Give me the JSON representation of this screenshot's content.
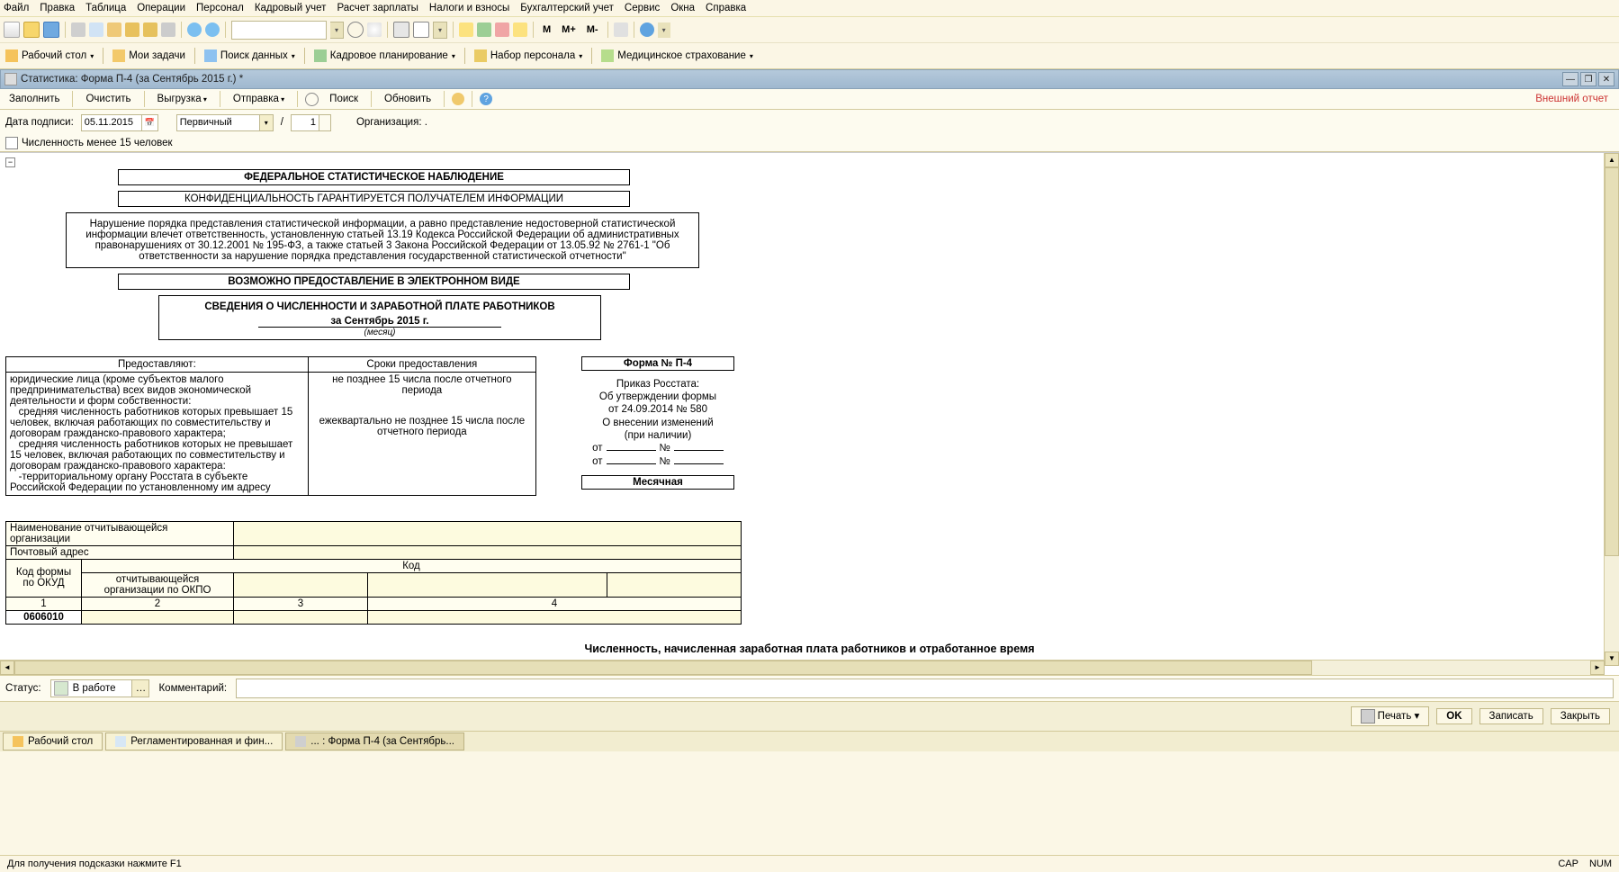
{
  "main_menu": [
    "Файл",
    "Правка",
    "Таблица",
    "Операции",
    "Персонал",
    "Кадровый учет",
    "Расчет зарплаты",
    "Налоги и взносы",
    "Бухгалтерский учет",
    "Сервис",
    "Окна",
    "Справка"
  ],
  "toolbar1": {
    "m_labels": [
      "M",
      "M+",
      "M-"
    ]
  },
  "toolbar2": [
    {
      "icon": "ic-desk",
      "label": "Рабочий стол",
      "dd": true
    },
    {
      "icon": "ic-task",
      "label": "Мои задачи"
    },
    {
      "icon": "ic-data",
      "label": "Поиск данных",
      "dd": true
    },
    {
      "icon": "ic-plan",
      "label": "Кадровое планирование",
      "dd": true
    },
    {
      "icon": "ic-hire",
      "label": "Набор персонала",
      "dd": true
    },
    {
      "icon": "ic-med",
      "label": "Медицинское страхование",
      "dd": true
    }
  ],
  "child_title": "Статистика: Форма П-4 (за Сентябрь 2015 г.) *",
  "child_tb": {
    "fill": "Заполнить",
    "clear": "Очистить",
    "export": "Выгрузка",
    "send": "Отправка",
    "search": "Поиск",
    "refresh": "Обновить"
  },
  "ext_report": "Внешний отчет",
  "params": {
    "date_label": "Дата подписи:",
    "date_val": "05.11.2015",
    "type_val": "Первичный",
    "slash": "/",
    "num_val": "1",
    "org_label": "Организация: ."
  },
  "chk_label": "Численность менее 15 человек",
  "doc": {
    "box1": "ФЕДЕРАЛЬНОЕ СТАТИСТИЧЕСКОЕ НАБЛЮДЕНИЕ",
    "box2": "КОНФИДЕНЦИАЛЬНОСТЬ ГАРАНТИРУЕТСЯ ПОЛУЧАТЕЛЕМ ИНФОРМАЦИИ",
    "box3": "Нарушение порядка представления статистической информации, а равно представление недостоверной статистической информации влечет ответственность, установленную статьей 13.19 Кодекса Российской Федерации об административных правонарушениях от 30.12.2001 № 195-ФЗ, а также статьей 3 Закона Российской Федерации от 13.05.92 № 2761-1 \"Об ответственности за нарушение порядка представления государственной статистической отчетности\"",
    "box4": "ВОЗМОЖНО ПРЕДОСТАВЛЕНИЕ В ЭЛЕКТРОННОМ ВИДЕ",
    "box5_title": "СВЕДЕНИЯ О ЧИСЛЕННОСТИ И ЗАРАБОТНОЙ ПЛАТЕ РАБОТНИКОВ",
    "box5_period": "за Сентябрь 2015 г.",
    "box5_sub": "(месяц)",
    "tblA": {
      "h1": "Предоставляют:",
      "h2": "Сроки предоставления",
      "c1": "юридические лица (кроме субъектов малого предпринимательства) всех видов экономической деятельности и форм собственности:\n   средняя численность работников которых превышает 15 человек, включая работающих по совместительству и договорам гражданско-правового характера;\n   средняя численность работников которых не превышает 15 человек, включая работающих по совместительству и договорам гражданско-правового характера:\n   -территориальному органу Росстата в субъекте Российской Федерации по установленному им адресу",
      "c2a": "не позднее 15 числа после отчетного периода",
      "c2b": "ежеквартально не позднее 15 числа после отчетного периода"
    },
    "form_no": "Форма № П-4",
    "order": {
      "l1": "Приказ Росстата:",
      "l2": "Об утверждении формы",
      "l3": "от 24.09.2014 № 580",
      "l4": "О внесении изменений",
      "l5": "(при наличии)",
      "ot": "от",
      "no": "№"
    },
    "month": "Месячная",
    "tblB": {
      "r1": "Наименование отчитывающейся организации",
      "r2": "Почтовый адрес",
      "code": "Код",
      "okud_h": "Код формы по ОКУД",
      "okpo_h": "отчитывающейся организации по ОКПО",
      "nums": [
        "1",
        "2",
        "3",
        "4"
      ],
      "okud_v": "0606010"
    },
    "sect": "Численность, начисленная заработная плата работников и отработанное время"
  },
  "status_label": "Статус:",
  "status_val": "В работе",
  "comment_label": "Комментарий:",
  "okrow": {
    "print": "Печать",
    "ok": "OK",
    "save": "Записать",
    "close": "Закрыть"
  },
  "tabs": [
    "Рабочий стол",
    "Регламентированная и фин...",
    "... : Форма П-4 (за Сентябрь..."
  ],
  "sbar_hint": "Для получения подсказки нажмите F1",
  "sbar_right": [
    "CAP",
    "NUM"
  ]
}
